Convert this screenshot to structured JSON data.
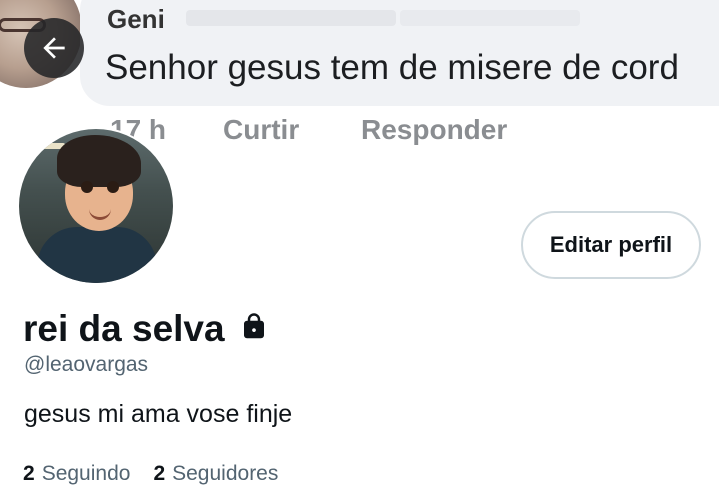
{
  "comment": {
    "author": "Geni",
    "text": "Senhor gesus tem de misere de cord",
    "time": "17 h",
    "like_label": "Curtir",
    "reply_label": "Responder"
  },
  "profile": {
    "edit_button_label": "Editar perfil",
    "display_name": "rei da selva",
    "handle": "@leaovargas",
    "bio": "gesus mi ama vose finje",
    "following_count": "2",
    "following_label": "Seguindo",
    "followers_count": "2",
    "followers_label": "Seguidores"
  },
  "icons": {
    "back": "arrow-left-icon",
    "protected": "lock-icon"
  },
  "colors": {
    "text_primary": "#0f1419",
    "text_secondary": "#536471",
    "button_border": "#cfd9de",
    "back_button_bg": "#242628",
    "comment_bubble_bg": "#f0f2f5"
  }
}
